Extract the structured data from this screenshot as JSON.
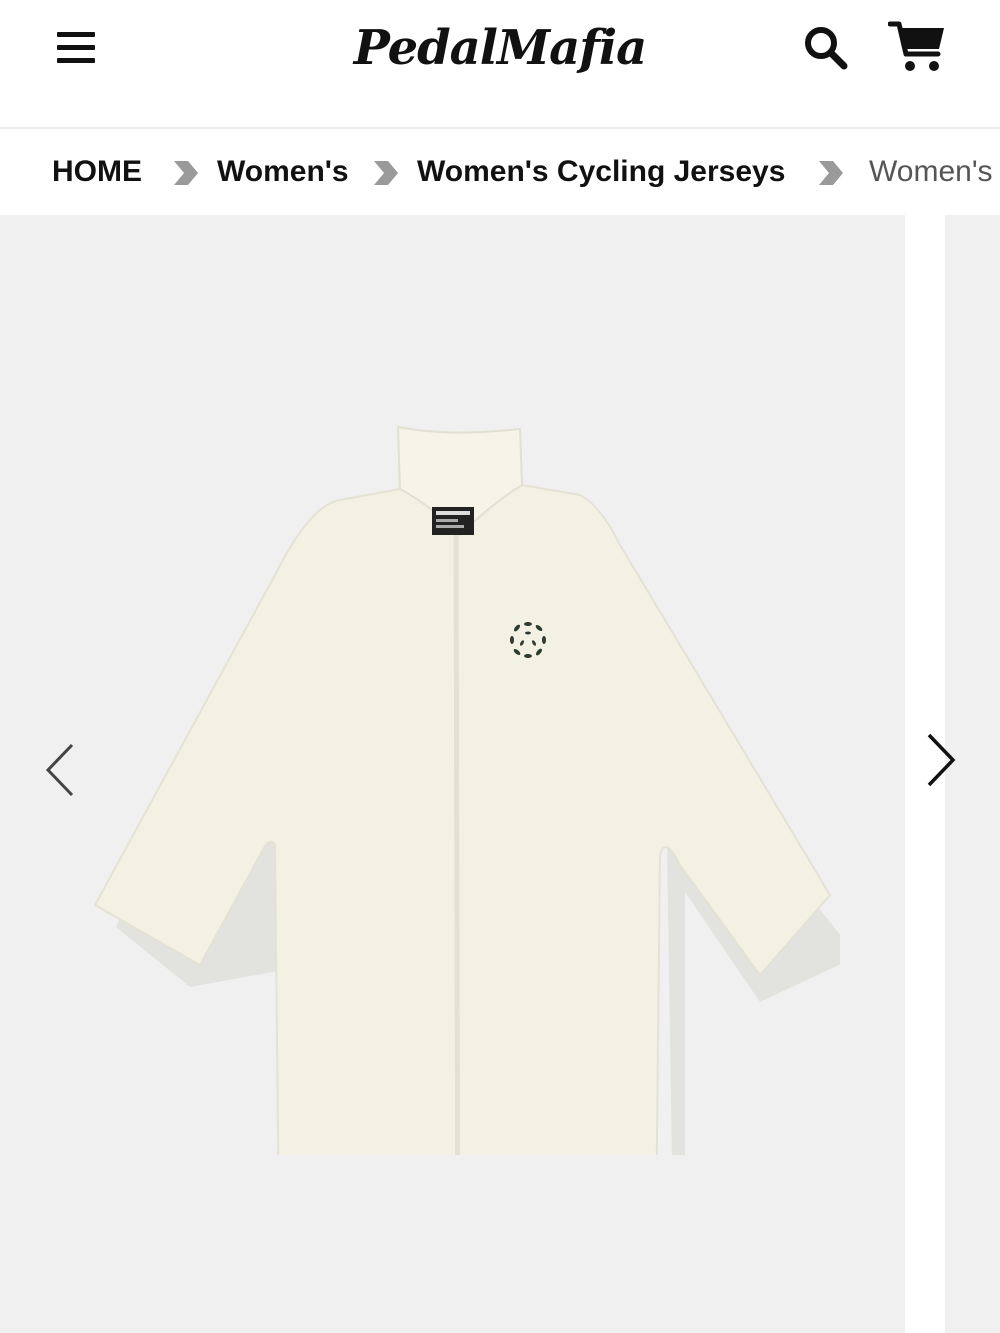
{
  "header": {
    "logo_text": "PedalMafia",
    "menu_icon": "hamburger-menu-icon",
    "search_icon": "search-icon",
    "cart_icon": "cart-icon"
  },
  "breadcrumb": {
    "items": [
      {
        "label": "HOME"
      },
      {
        "label": "Women's"
      },
      {
        "label": "Women's Cycling Jerseys"
      },
      {
        "label": "Women's"
      }
    ],
    "separator_icon": "chevron-right-icon"
  },
  "gallery": {
    "prev_icon": "chevron-left-icon",
    "next_icon": "chevron-right-icon",
    "image_colors": {
      "background": "#f0f0f0",
      "jersey": "#f3f1e4",
      "shadow": "#d9d8d3"
    }
  },
  "colors": {
    "text": "#111111",
    "separator": "#9a9a9a"
  }
}
